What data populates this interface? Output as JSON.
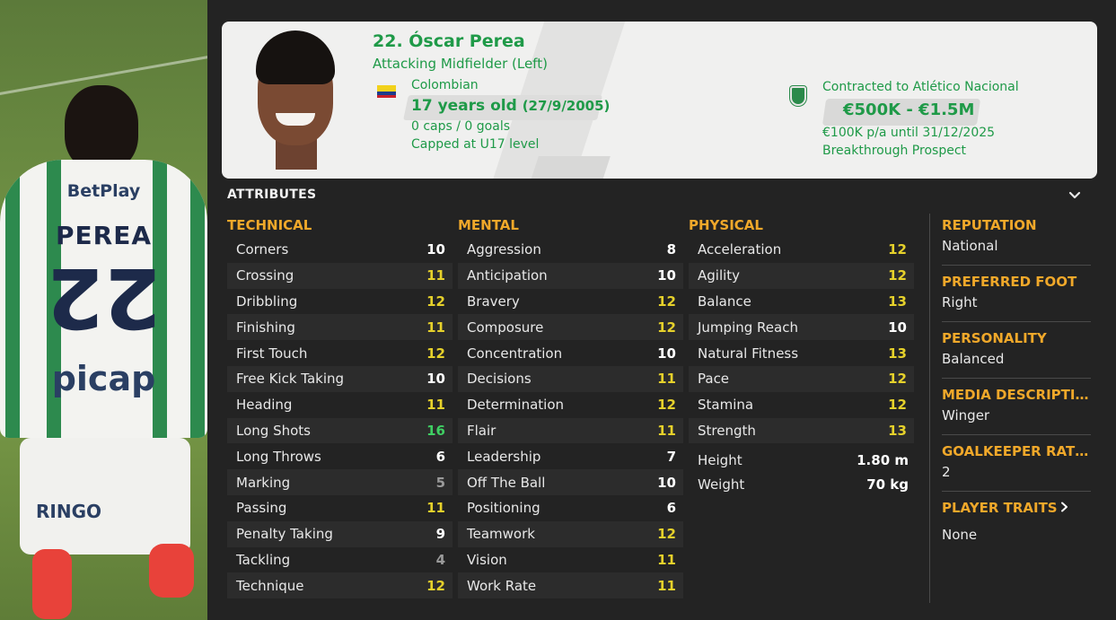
{
  "photo": {
    "sponsor_top": "BetPlay",
    "shirt_name": "PEREA",
    "shirt_number": "22",
    "sponsor_main": "picap",
    "shorts_sponsor": "RINGO"
  },
  "profile": {
    "name": "22. Óscar Perea",
    "position": "Attacking Midfielder (Left)",
    "nationality": "Colombian",
    "age": "17 years old",
    "dob": "(27/9/2005)",
    "caps": "0 caps / 0 goals",
    "capped_level": "Capped at U17 level",
    "contract": "Contracted to Atlético Nacional",
    "value": "€500K - €1.5M",
    "wage": "€100K p/a until 31/12/2025",
    "status": "Breakthrough Prospect",
    "colors": {
      "accent_green": "#1f9a48",
      "card_bg": "#f0f0ef"
    }
  },
  "attributes": {
    "title": "ATTRIBUTES",
    "technical": {
      "heading": "TECHNICAL",
      "items": [
        {
          "label": "Corners",
          "value": "10"
        },
        {
          "label": "Crossing",
          "value": "11"
        },
        {
          "label": "Dribbling",
          "value": "12"
        },
        {
          "label": "Finishing",
          "value": "11"
        },
        {
          "label": "First Touch",
          "value": "12"
        },
        {
          "label": "Free Kick Taking",
          "value": "10"
        },
        {
          "label": "Heading",
          "value": "11"
        },
        {
          "label": "Long Shots",
          "value": "16"
        },
        {
          "label": "Long Throws",
          "value": "6"
        },
        {
          "label": "Marking",
          "value": "5"
        },
        {
          "label": "Passing",
          "value": "11"
        },
        {
          "label": "Penalty Taking",
          "value": "9"
        },
        {
          "label": "Tackling",
          "value": "4"
        },
        {
          "label": "Technique",
          "value": "12"
        }
      ]
    },
    "mental": {
      "heading": "MENTAL",
      "items": [
        {
          "label": "Aggression",
          "value": "8"
        },
        {
          "label": "Anticipation",
          "value": "10"
        },
        {
          "label": "Bravery",
          "value": "12"
        },
        {
          "label": "Composure",
          "value": "12"
        },
        {
          "label": "Concentration",
          "value": "10"
        },
        {
          "label": "Decisions",
          "value": "11"
        },
        {
          "label": "Determination",
          "value": "12"
        },
        {
          "label": "Flair",
          "value": "11"
        },
        {
          "label": "Leadership",
          "value": "7"
        },
        {
          "label": "Off The Ball",
          "value": "10"
        },
        {
          "label": "Positioning",
          "value": "6"
        },
        {
          "label": "Teamwork",
          "value": "12"
        },
        {
          "label": "Vision",
          "value": "11"
        },
        {
          "label": "Work Rate",
          "value": "11"
        }
      ]
    },
    "physical": {
      "heading": "PHYSICAL",
      "items": [
        {
          "label": "Acceleration",
          "value": "12"
        },
        {
          "label": "Agility",
          "value": "12"
        },
        {
          "label": "Balance",
          "value": "13"
        },
        {
          "label": "Jumping Reach",
          "value": "10"
        },
        {
          "label": "Natural Fitness",
          "value": "13"
        },
        {
          "label": "Pace",
          "value": "12"
        },
        {
          "label": "Stamina",
          "value": "12"
        },
        {
          "label": "Strength",
          "value": "13"
        }
      ],
      "height_label": "Height",
      "height_value": "1.80 m",
      "weight_label": "Weight",
      "weight_value": "70 kg"
    },
    "value_colors": {
      "low": "#9a9a9a",
      "mid": "#ffffff",
      "good": "#e6d12b",
      "great": "#3fcf63"
    }
  },
  "info": {
    "reputation_label": "REPUTATION",
    "reputation_value": "National",
    "foot_label": "PREFERRED FOOT",
    "foot_value": "Right",
    "personality_label": "PERSONALITY",
    "personality_value": "Balanced",
    "media_label": "MEDIA DESCRIPTION",
    "media_value": "Winger",
    "gk_label": "GOALKEEPER RATI...",
    "gk_value": "2",
    "traits_label": "PLAYER TRAITS",
    "traits_value": "None"
  }
}
